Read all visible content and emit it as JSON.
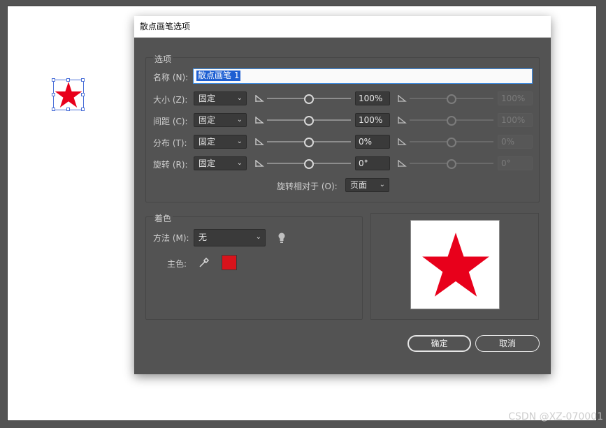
{
  "dialog": {
    "title": "散点画笔选项",
    "options_group": "选项",
    "name_label": "名称 (N):",
    "name_value": "散点画笔 1",
    "rows": [
      {
        "label": "大小 (Z):",
        "mode": "固定",
        "value": "100%",
        "value2": "100%"
      },
      {
        "label": "间距 (C):",
        "mode": "固定",
        "value": "100%",
        "value2": "100%"
      },
      {
        "label": "分布 (T):",
        "mode": "固定",
        "value": "0%",
        "value2": "0%"
      },
      {
        "label": "旋转 (R):",
        "mode": "固定",
        "value": "0°",
        "value2": "0°"
      }
    ],
    "rotation_relative_label": "旋转相对于 (O):",
    "rotation_relative_value": "页面",
    "colorization_group": "着色",
    "method_label": "方法 (M):",
    "method_value": "无",
    "key_color_label": "主色:",
    "key_color": "#d8131b",
    "ok_label": "确定",
    "cancel_label": "取消"
  },
  "icons": {
    "tip": "lightbulb-icon",
    "eyedropper": "eyedropper-icon",
    "range_min": "slider-min-icon"
  },
  "colors": {
    "star": "#e8001b",
    "dialog_bg": "#535353",
    "selection": "#4a6fd8"
  },
  "watermark": "CSDN @XZ-070001"
}
